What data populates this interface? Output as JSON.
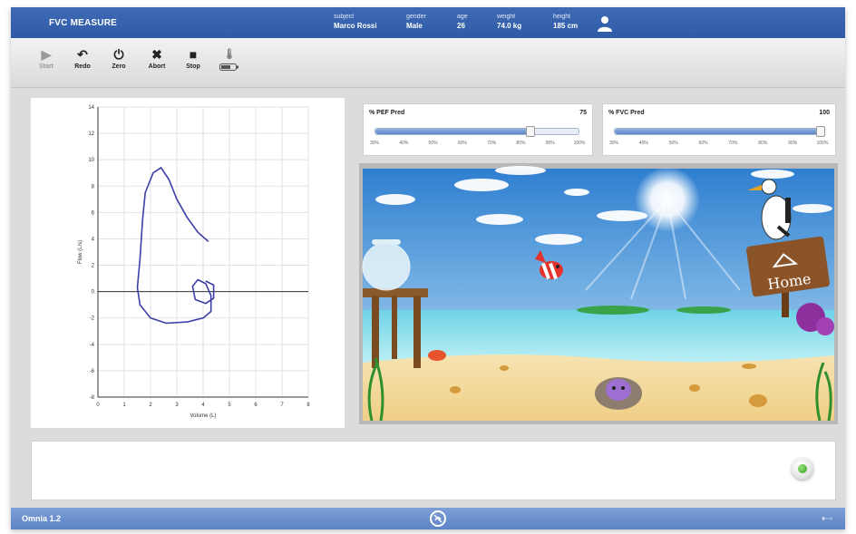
{
  "header": {
    "title": "FVC MEASURE",
    "patient": [
      {
        "label": "subject",
        "value": "Marco Rossi"
      },
      {
        "label": "gender",
        "value": "Male"
      },
      {
        "label": "age",
        "value": "26"
      },
      {
        "label": "weight",
        "value": "74.0 kg"
      },
      {
        "label": "height",
        "value": "185 cm"
      }
    ],
    "user_icon": "user-icon"
  },
  "toolbar": {
    "buttons": [
      {
        "label": "Start",
        "icon": "play-icon",
        "enabled": false
      },
      {
        "label": "Redo",
        "icon": "redo-icon",
        "enabled": true
      },
      {
        "label": "Zero",
        "icon": "zero-icon",
        "enabled": true
      },
      {
        "label": "Abort",
        "icon": "close-icon",
        "enabled": true
      },
      {
        "label": "Stop",
        "icon": "stop-icon",
        "enabled": true
      }
    ],
    "extra_icons": [
      "thermometer-icon",
      "battery-icon"
    ]
  },
  "chart_data": {
    "type": "line",
    "title": "",
    "xlabel": "Volume (L)",
    "ylabel": "Flow (L/s)",
    "xlim": [
      0,
      8
    ],
    "ylim": [
      -8,
      14
    ],
    "xticks": [
      "0",
      "1",
      "2",
      "3",
      "4",
      "5",
      "6",
      "7",
      "8"
    ],
    "yticks": [
      "14",
      "12",
      "10",
      "8",
      "6",
      "4",
      "2",
      "0",
      "-2",
      "-4",
      "-6",
      "-8"
    ],
    "grid": true,
    "series": [
      {
        "color": "#3b3fa6",
        "points": [
          [
            4.2,
            3.8
          ],
          [
            3.8,
            4.5
          ],
          [
            3.4,
            5.6
          ],
          [
            3.0,
            7.0
          ],
          [
            2.7,
            8.5
          ],
          [
            2.4,
            9.4
          ],
          [
            2.1,
            9.0
          ],
          [
            1.8,
            7.5
          ],
          [
            1.7,
            5.5
          ],
          [
            1.6,
            2.5
          ],
          [
            1.5,
            0.3
          ],
          [
            1.6,
            -1.0
          ],
          [
            2.0,
            -2.0
          ],
          [
            2.6,
            -2.4
          ],
          [
            3.4,
            -2.3
          ],
          [
            4.0,
            -2.0
          ],
          [
            4.3,
            -1.5
          ],
          [
            4.3,
            -0.3
          ],
          [
            4.1,
            0.6
          ],
          [
            3.8,
            0.9
          ],
          [
            3.6,
            0.4
          ],
          [
            3.7,
            -0.6
          ],
          [
            4.1,
            -0.9
          ],
          [
            4.4,
            -0.5
          ],
          [
            4.4,
            0.5
          ],
          [
            4.1,
            0.8
          ]
        ]
      }
    ]
  },
  "gauges": {
    "pef": {
      "title": "% PEF Pred",
      "value": "75",
      "fraction": 0.75,
      "ticks": [
        "30%",
        "40%",
        "50%",
        "60%",
        "70%",
        "80%",
        "90%",
        "100%"
      ]
    },
    "fvc": {
      "title": "% FVC Pred",
      "value": "100",
      "fraction": 1.0,
      "ticks": [
        "30%",
        "40%",
        "50%",
        "60%",
        "70%",
        "80%",
        "90%",
        "100%"
      ]
    }
  },
  "game": {
    "sign_text": "Home"
  },
  "message": {
    "button_icon": "go-icon"
  },
  "footer": {
    "version": "Omnia 1.2",
    "logo_icon": "app-logo-icon",
    "usb_icon": "usb-icon"
  },
  "colors": {
    "header_blue": "#2f5aa6",
    "footer_blue": "#6a8fcc",
    "curve": "#3b3fa6"
  }
}
